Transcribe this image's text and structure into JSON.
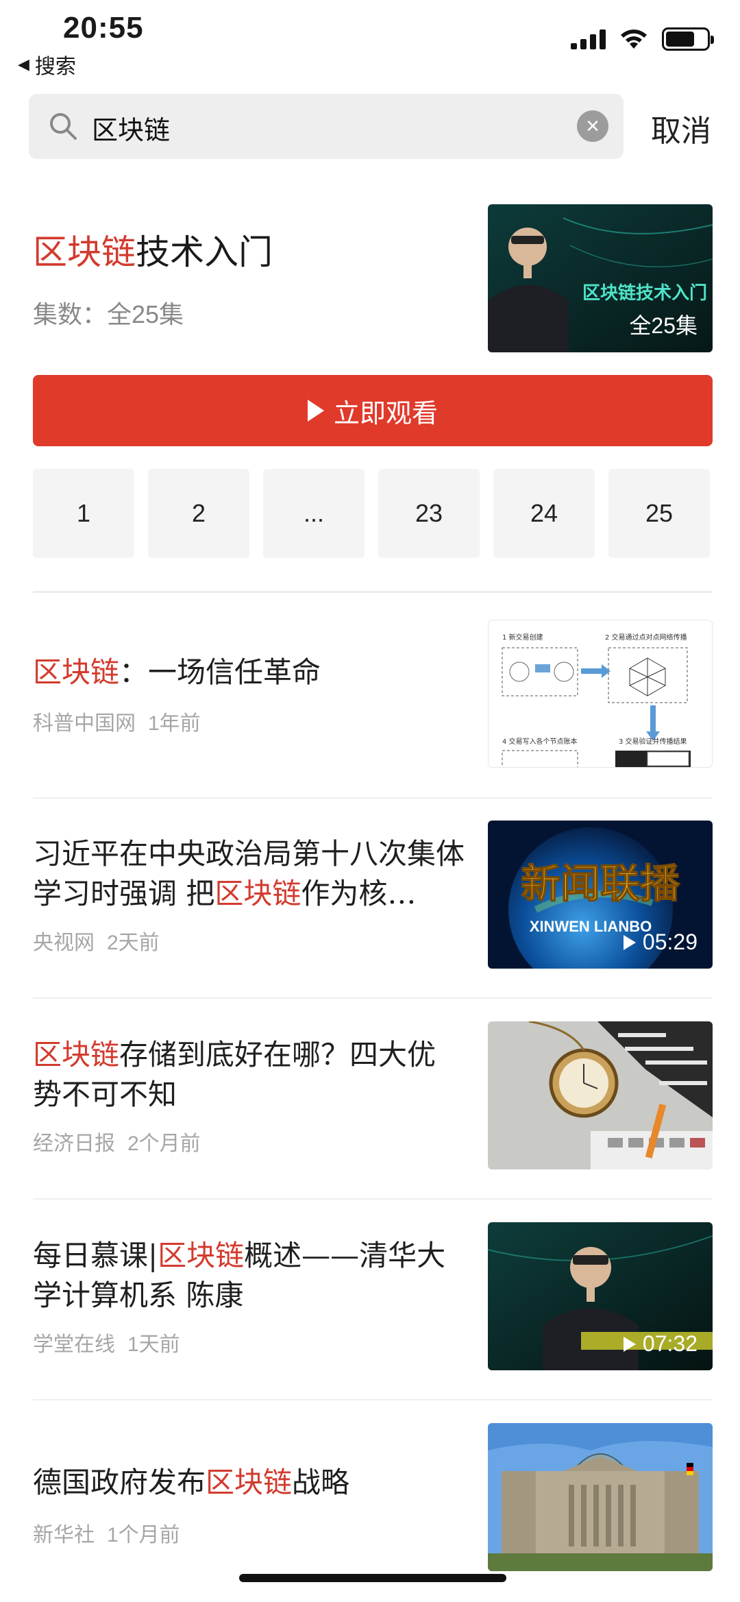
{
  "status_bar": {
    "time": "20:55",
    "back_label": "搜索"
  },
  "search": {
    "query": "区块链",
    "cancel_label": "取消"
  },
  "course": {
    "title_highlight": "区块链",
    "title_rest": "技术入门",
    "subtitle": "集数：全25集",
    "thumb_text": "区块链技术入门",
    "thumb_count": "全25集",
    "watch_label": "立即观看",
    "episodes": [
      "1",
      "2",
      "...",
      "23",
      "24",
      "25"
    ]
  },
  "news": [
    {
      "title_parts": [
        "",
        "区块链",
        "：一场信任革命"
      ],
      "source": "科普中国网",
      "time": "1年前",
      "thumb_labels": [
        "1 新交易创建",
        "2 交易通过点对点网络传播",
        "3 交易验证并传播结果",
        "4 交易写入各个节点账本"
      ]
    },
    {
      "title_parts": [
        "习近平在中央政治局第十八次集体学习时强调 把",
        "区块链",
        "作为核…"
      ],
      "source": "央视网",
      "time": "2天前",
      "thumb_title": "新闻联播",
      "thumb_subtitle": "XINWEN LIANBO",
      "duration": "05:29"
    },
    {
      "title_parts": [
        "",
        "区块链",
        "存储到底好在哪？四大优势不可不知"
      ],
      "source": "经济日报",
      "time": "2个月前"
    },
    {
      "title_parts": [
        "每日慕课|",
        "区块链",
        "概述——清华大学计算机系  陈康"
      ],
      "source": "学堂在线",
      "time": "1天前",
      "duration": "07:32"
    },
    {
      "title_parts": [
        "德国政府发布",
        "区块链",
        "战略"
      ],
      "source": "新华社",
      "time": "1个月前"
    }
  ],
  "colors": {
    "accent": "#e03a2b",
    "highlight": "#d23b2e"
  }
}
